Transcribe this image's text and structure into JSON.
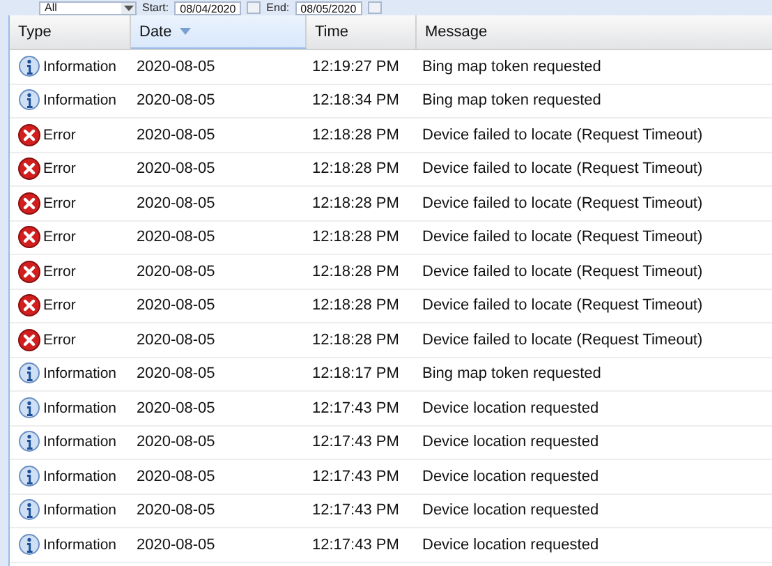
{
  "toolbar": {
    "type_filter": {
      "value": "All"
    },
    "start": {
      "label": "Start:",
      "value": "08/04/2020"
    },
    "end": {
      "label": "End:",
      "value": "08/05/2020"
    }
  },
  "table": {
    "columns": [
      {
        "label": "Type",
        "sorted": false
      },
      {
        "label": "Date",
        "sorted": true
      },
      {
        "label": "Time",
        "sorted": false
      },
      {
        "label": "Message",
        "sorted": false
      }
    ],
    "rows": [
      {
        "kind": "info",
        "type": "Information",
        "date": "2020-08-05",
        "time": "12:19:27 PM",
        "message": "Bing map token requested"
      },
      {
        "kind": "info",
        "type": "Information",
        "date": "2020-08-05",
        "time": "12:18:34 PM",
        "message": "Bing map token requested"
      },
      {
        "kind": "error",
        "type": "Error",
        "date": "2020-08-05",
        "time": "12:18:28 PM",
        "message": "Device failed to locate (Request Timeout)"
      },
      {
        "kind": "error",
        "type": "Error",
        "date": "2020-08-05",
        "time": "12:18:28 PM",
        "message": "Device failed to locate (Request Timeout)"
      },
      {
        "kind": "error",
        "type": "Error",
        "date": "2020-08-05",
        "time": "12:18:28 PM",
        "message": "Device failed to locate (Request Timeout)"
      },
      {
        "kind": "error",
        "type": "Error",
        "date": "2020-08-05",
        "time": "12:18:28 PM",
        "message": "Device failed to locate (Request Timeout)"
      },
      {
        "kind": "error",
        "type": "Error",
        "date": "2020-08-05",
        "time": "12:18:28 PM",
        "message": "Device failed to locate (Request Timeout)"
      },
      {
        "kind": "error",
        "type": "Error",
        "date": "2020-08-05",
        "time": "12:18:28 PM",
        "message": "Device failed to locate (Request Timeout)"
      },
      {
        "kind": "error",
        "type": "Error",
        "date": "2020-08-05",
        "time": "12:18:28 PM",
        "message": "Device failed to locate (Request Timeout)"
      },
      {
        "kind": "info",
        "type": "Information",
        "date": "2020-08-05",
        "time": "12:18:17 PM",
        "message": "Bing map token requested"
      },
      {
        "kind": "info",
        "type": "Information",
        "date": "2020-08-05",
        "time": "12:17:43 PM",
        "message": "Device location requested"
      },
      {
        "kind": "info",
        "type": "Information",
        "date": "2020-08-05",
        "time": "12:17:43 PM",
        "message": "Device location requested"
      },
      {
        "kind": "info",
        "type": "Information",
        "date": "2020-08-05",
        "time": "12:17:43 PM",
        "message": "Device location requested"
      },
      {
        "kind": "info",
        "type": "Information",
        "date": "2020-08-05",
        "time": "12:17:43 PM",
        "message": "Device location requested"
      },
      {
        "kind": "info",
        "type": "Information",
        "date": "2020-08-05",
        "time": "12:17:43 PM",
        "message": "Device location requested"
      }
    ]
  }
}
